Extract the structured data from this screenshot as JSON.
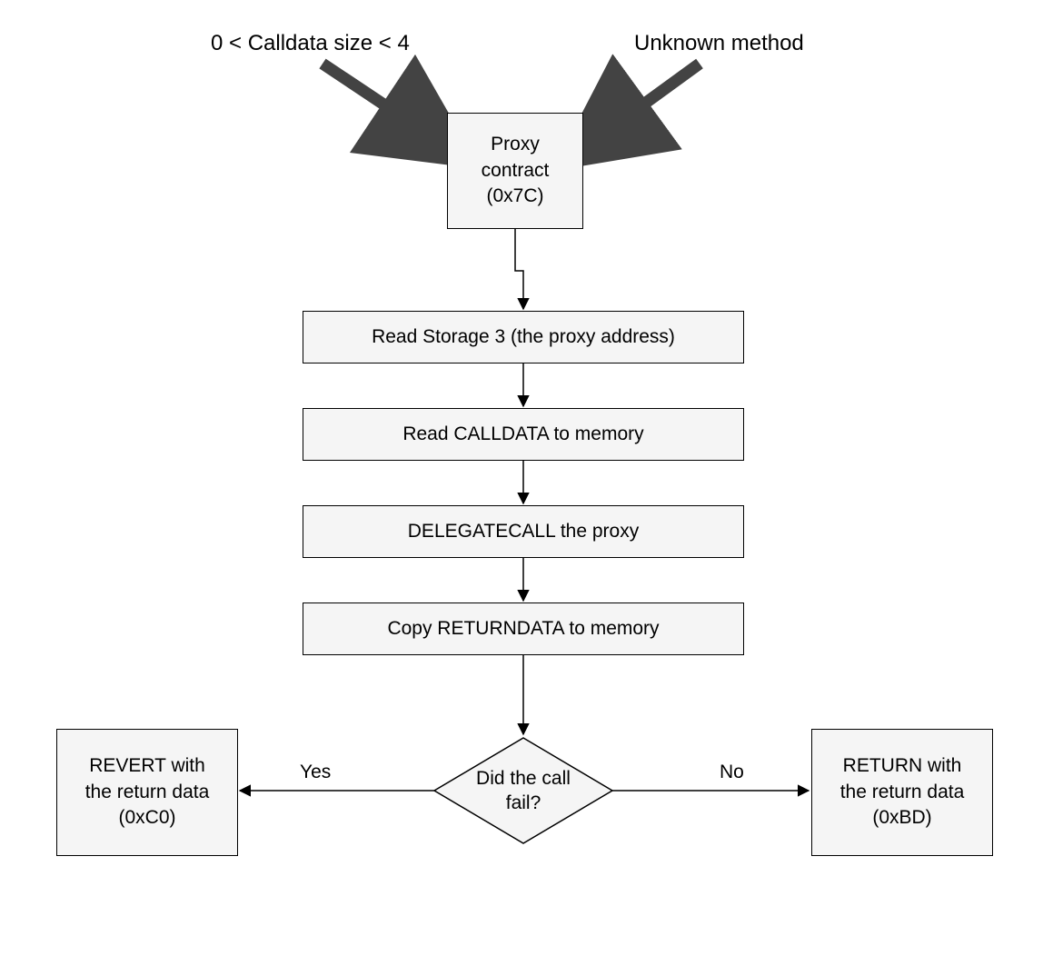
{
  "entry_labels": {
    "left": "0 < Calldata size < 4",
    "right": "Unknown method"
  },
  "nodes": {
    "proxy": {
      "line1": "Proxy",
      "line2": "contract",
      "line3": "(0x7C)"
    },
    "read_storage": "Read Storage 3 (the proxy address)",
    "read_calldata": "Read CALLDATA to memory",
    "delegatecall": "DELEGATECALL the proxy",
    "copy_returndata": "Copy RETURNDATA to memory",
    "decision": "Did the call fail?",
    "revert": {
      "line1": "REVERT with",
      "line2": "the return data",
      "line3": "(0xC0)"
    },
    "return": {
      "line1": "RETURN with",
      "line2": "the return data",
      "line3": "(0xBD)"
    }
  },
  "edges": {
    "yes": "Yes",
    "no": "No"
  }
}
